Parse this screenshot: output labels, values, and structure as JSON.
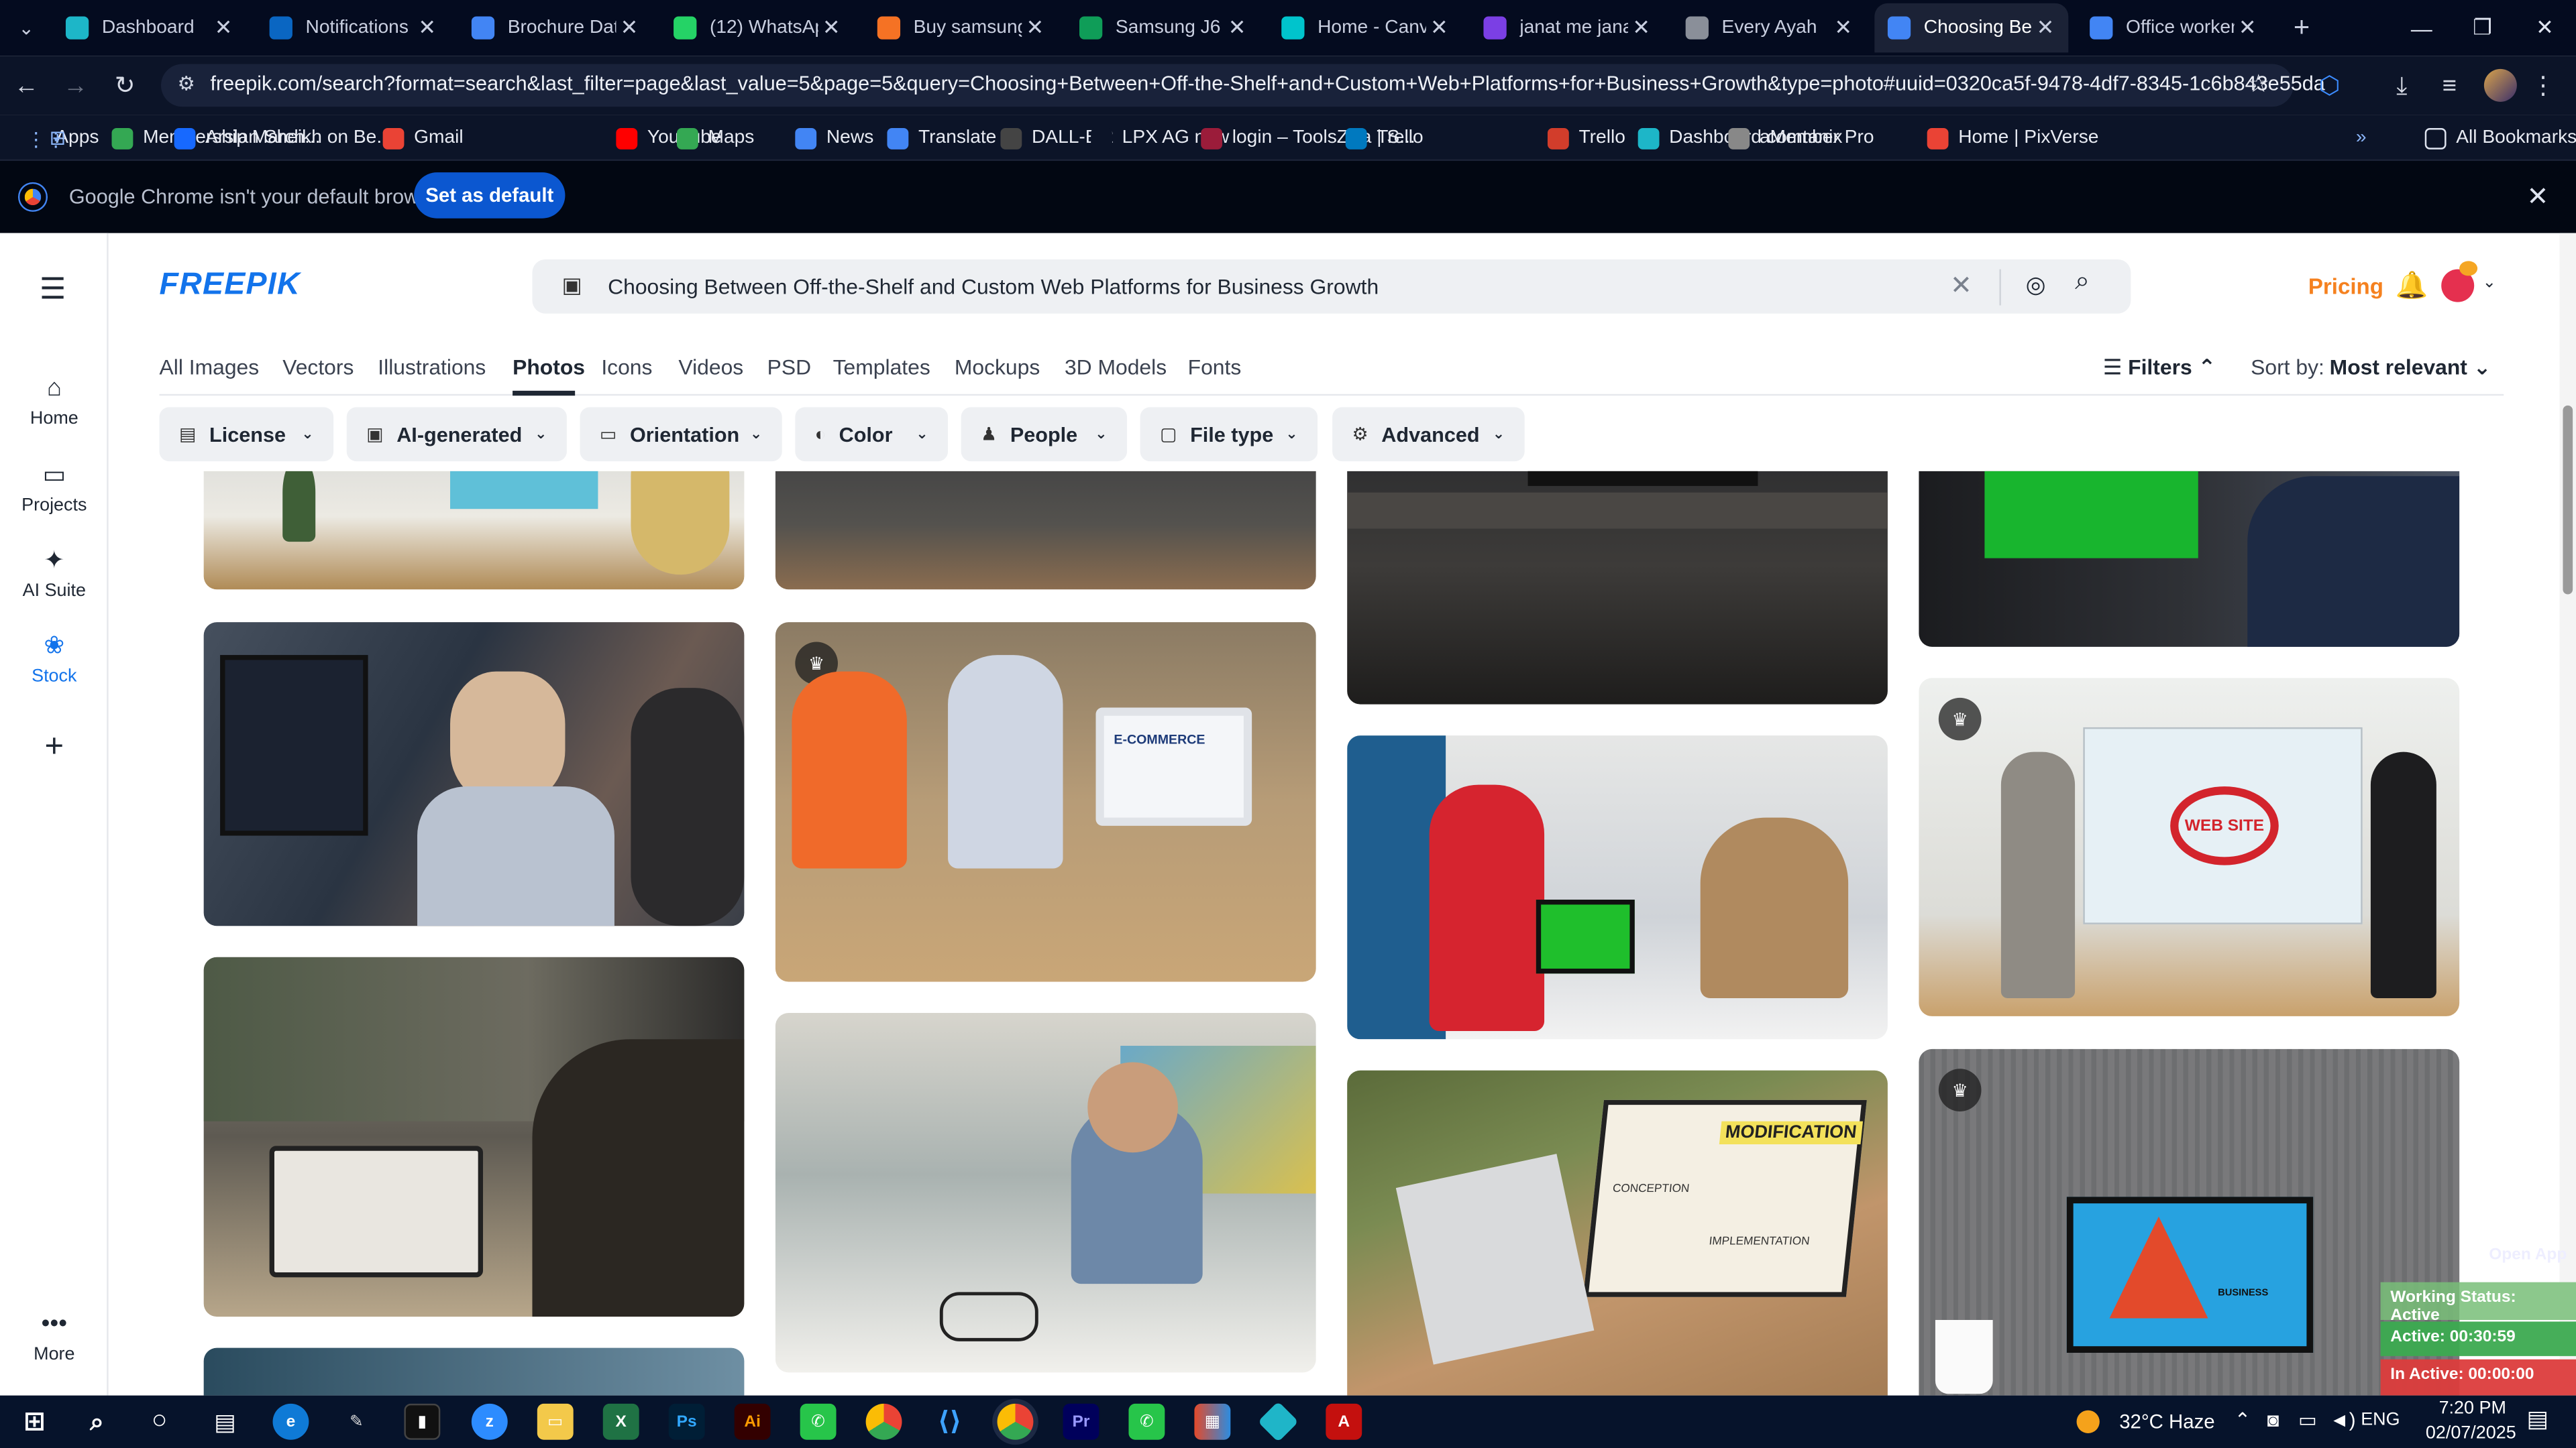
{
  "browser": {
    "tabs": [
      {
        "title": "Dashboard",
        "icon": "dashboard-icon",
        "color": "#1db6c8"
      },
      {
        "title": "Notifications |",
        "icon": "linkedin-icon",
        "color": "#0a66c2"
      },
      {
        "title": "Brochure Data",
        "icon": "docs-icon",
        "color": "#4285f4"
      },
      {
        "title": "(12) WhatsApp",
        "icon": "whatsapp-icon",
        "color": "#25d366"
      },
      {
        "title": "Buy samsung g",
        "icon": "shop-icon",
        "color": "#f57224"
      },
      {
        "title": "Samsung J6 Pl",
        "icon": "store-icon",
        "color": "#0f9d58"
      },
      {
        "title": "Home - Canva",
        "icon": "canva-icon",
        "color": "#00c4cc"
      },
      {
        "title": "janat me jana",
        "icon": "video-icon",
        "color": "#7b3fe4"
      },
      {
        "title": "Every Ayah",
        "icon": "globe-icon",
        "color": "#8a8f99"
      },
      {
        "title": "Choosing Betw",
        "icon": "docs-icon",
        "color": "#4285f4"
      },
      {
        "title": "Office worker",
        "icon": "docs-icon",
        "color": "#4285f4"
      }
    ],
    "new_tab": "+",
    "url": "freepik.com/search?format=search&last_filter=page&last_value=5&page=5&query=Choosing+Between+Off-the-Shelf+and+Custom+Web+Platforms+for+Business+Growth&type=photo#uuid=0320ca5f-9478-4df7-8345-1c6b843e55da",
    "bookmarks": [
      {
        "label": "Apps",
        "color": "#4285f4"
      },
      {
        "label": "Membership March...",
        "color": "#34a853"
      },
      {
        "label": "Arslan Sheikh on Be...",
        "color": "#1769ff"
      },
      {
        "label": "Gmail",
        "color": "#ea4335"
      },
      {
        "label": "YouTube",
        "color": "#ff0000"
      },
      {
        "label": "Maps",
        "color": "#34a853"
      },
      {
        "label": "News",
        "color": "#4285f4"
      },
      {
        "label": "Translate",
        "color": "#4285f4"
      },
      {
        "label": "DALL-E 2",
        "color": "#444444"
      },
      {
        "label": "LPX AG new",
        "color": "#0c1428"
      },
      {
        "label": "login – ToolsZilla | S...",
        "color": "#9b1c3a"
      },
      {
        "label": "Trello",
        "color": "#0079bf"
      },
      {
        "label": "Trello",
        "color": "#d23d2b"
      },
      {
        "label": "Dashboard comtanix",
        "color": "#1db6c8"
      },
      {
        "label": "aMember Pro",
        "color": "#888888"
      },
      {
        "label": "Home | PixVerse",
        "color": "#ea4335"
      }
    ],
    "all_bookmarks": "All Bookmarks"
  },
  "infobar": {
    "message": "Google Chrome isn't your default browser",
    "button": "Set as default"
  },
  "sidenav": [
    {
      "label": "Home",
      "icon": "home-icon"
    },
    {
      "label": "Projects",
      "icon": "folder-icon"
    },
    {
      "label": "AI Suite",
      "icon": "sparkle-icon"
    },
    {
      "label": "Stock",
      "icon": "stock-icon"
    },
    {
      "label": "",
      "icon": "plus-icon"
    },
    {
      "label": "More",
      "icon": "more-icon"
    }
  ],
  "header": {
    "logo": "FREEPIK",
    "search_value": "Choosing Between Off-the-Shelf and Custom Web Platforms for Business Growth",
    "pricing": "Pricing"
  },
  "categories": [
    "All Images",
    "Vectors",
    "Illustrations",
    "Photos",
    "Icons",
    "Videos",
    "PSD",
    "Templates",
    "Mockups",
    "3D Models",
    "Fonts"
  ],
  "active_category": "Photos",
  "filters_label": "Filters",
  "sort": {
    "label": "Sort by:",
    "value": "Most relevant"
  },
  "filter_chips": [
    "License",
    "AI-generated",
    "Orientation",
    "Color",
    "People",
    "File type",
    "Advanced"
  ],
  "overlay": {
    "open_app": "Open App",
    "status": "Working Status: Active",
    "active": "Active: 00:30:59",
    "inactive": "In Active: 00:00:00"
  },
  "taskbar": {
    "weather": "32°C Haze",
    "lang": "ENG",
    "time": "7:20 PM",
    "date": "02/07/2025"
  },
  "photo_text": {
    "ecommerce": "E-COMMERCE",
    "website": "WEB SITE",
    "modification": "MODIFICATION",
    "conception": "CONCEPTION",
    "implementation": "IMPLEMENTATION",
    "business": "BUSINESS"
  }
}
